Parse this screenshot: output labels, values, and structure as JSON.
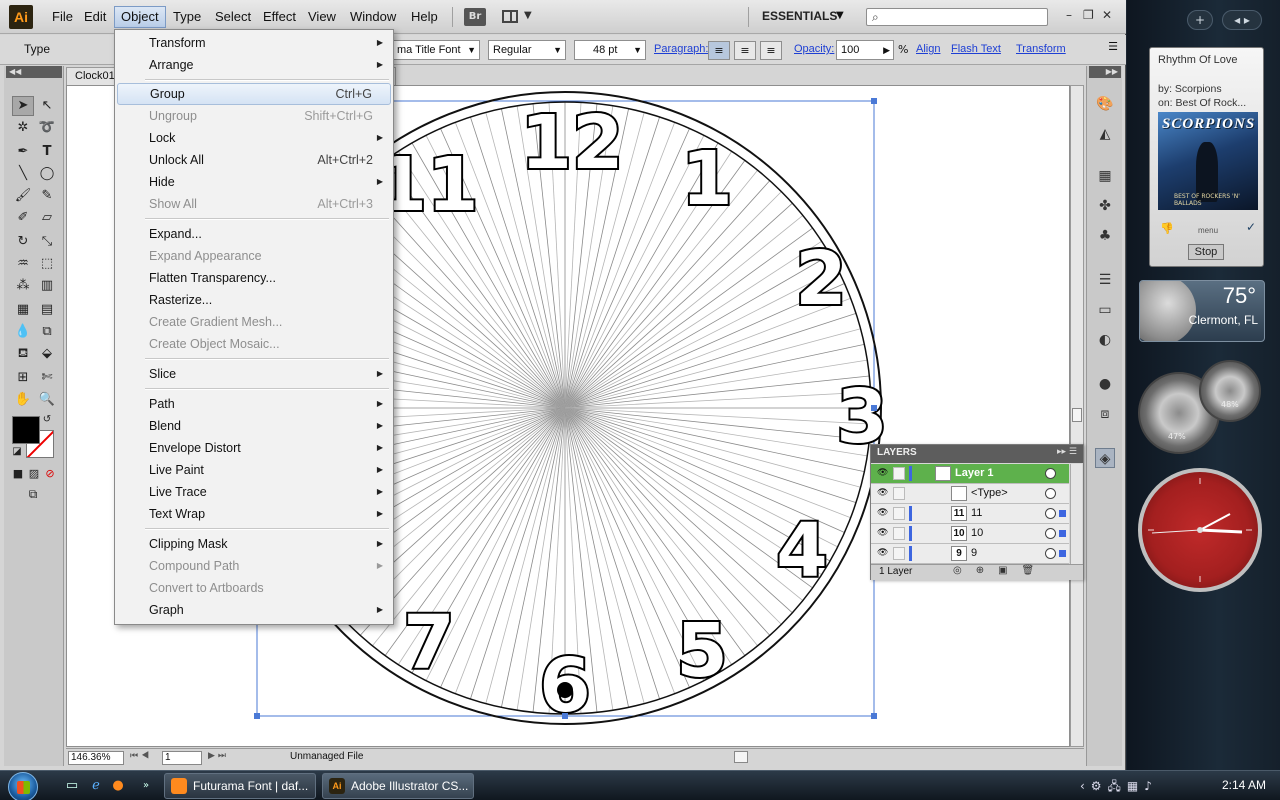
{
  "app": {
    "logo": "Ai",
    "menus": [
      "File",
      "Edit",
      "Object",
      "Type",
      "Select",
      "Effect",
      "View",
      "Window",
      "Help"
    ],
    "active_menu": "Object",
    "bridge_label": "Br",
    "workspace": "ESSENTIALS",
    "window_controls": [
      "–",
      "❐",
      "✕"
    ]
  },
  "control_bar": {
    "type_label": "Type",
    "font_family": "ma Title Font",
    "font_style": "Regular",
    "font_size": "48 pt",
    "paragraph_label": "Paragraph:",
    "opacity_label": "Opacity:",
    "opacity_value": "100",
    "opacity_unit": "%",
    "align_link": "Align",
    "flash_text_link": "Flash Text",
    "transform_link": "Transform"
  },
  "document": {
    "tab_title": "Clock01",
    "zoom": "146.36%",
    "page": "1",
    "status": "Unmanaged File"
  },
  "clock_numbers": [
    "12",
    "1",
    "2",
    "3",
    "4",
    "5",
    "6",
    "7",
    "11"
  ],
  "object_menu": {
    "items": [
      {
        "label": "Transform",
        "submenu": true
      },
      {
        "label": "Arrange",
        "submenu": true
      },
      {
        "label": "Group",
        "shortcut": "Ctrl+G",
        "highlighted": true
      },
      {
        "label": "Ungroup",
        "shortcut": "Shift+Ctrl+G",
        "disabled": true
      },
      {
        "label": "Lock",
        "submenu": true
      },
      {
        "label": "Unlock All",
        "shortcut": "Alt+Ctrl+2"
      },
      {
        "label": "Hide",
        "submenu": true
      },
      {
        "label": "Show All",
        "shortcut": "Alt+Ctrl+3",
        "disabled": true
      },
      {
        "label": "Expand..."
      },
      {
        "label": "Expand Appearance",
        "disabled": true
      },
      {
        "label": "Flatten Transparency..."
      },
      {
        "label": "Rasterize..."
      },
      {
        "label": "Create Gradient Mesh...",
        "disabled": true
      },
      {
        "label": "Create Object Mosaic...",
        "disabled": true
      },
      {
        "label": "Slice",
        "submenu": true
      },
      {
        "label": "Path",
        "submenu": true
      },
      {
        "label": "Blend",
        "submenu": true
      },
      {
        "label": "Envelope Distort",
        "submenu": true
      },
      {
        "label": "Live Paint",
        "submenu": true
      },
      {
        "label": "Live Trace",
        "submenu": true
      },
      {
        "label": "Text Wrap",
        "submenu": true
      },
      {
        "label": "Clipping Mask",
        "submenu": true
      },
      {
        "label": "Compound Path",
        "submenu": true,
        "disabled": true
      },
      {
        "label": "Convert to Artboards",
        "disabled": true
      },
      {
        "label": "Graph",
        "submenu": true
      }
    ]
  },
  "layers_panel": {
    "title": "LAYERS",
    "rows": [
      {
        "name": "Layer 1",
        "thumb": ""
      },
      {
        "name": "<Type>",
        "thumb": ""
      },
      {
        "name": "11",
        "thumb": "11"
      },
      {
        "name": "10",
        "thumb": "10"
      },
      {
        "name": "9",
        "thumb": "9"
      }
    ],
    "footer": "1 Layer"
  },
  "sidebar": {
    "media": {
      "title": "Rhythm Of Love",
      "artist_line": "by: Scorpions",
      "album_line": "on: Best Of Rock...",
      "album_band": "SCORPIONS",
      "album_caption": "BEST OF ROCKERS 'N' BALLADS",
      "menu_label": "menu",
      "stop_label": "Stop"
    },
    "weather": {
      "temp": "75°",
      "city": "Clermont, FL"
    },
    "cpu_percent": "47%",
    "memory_percent": "48%"
  },
  "taskbar": {
    "tasks": [
      "Futurama Font | daf...",
      "Adobe Illustrator CS..."
    ],
    "time": "2:14 AM"
  },
  "colors": {
    "layer_green": "#5eb14c",
    "selection_blue": "#3d66e0",
    "clock_red": "#a31f1f"
  }
}
